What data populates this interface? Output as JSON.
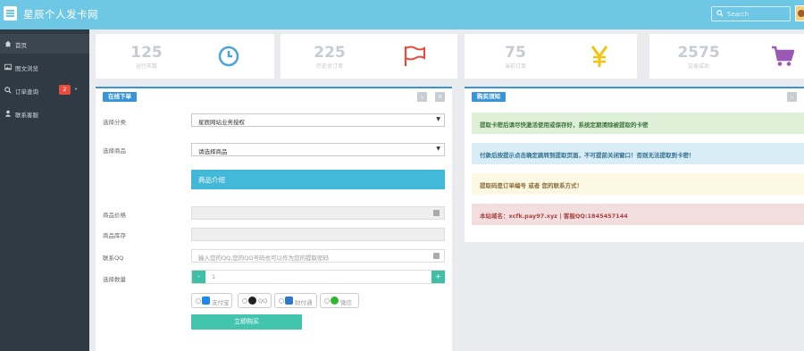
{
  "header": {
    "title": "星辰个人发卡网",
    "search_placeholder": "Search"
  },
  "sidebar": {
    "items": [
      {
        "label": "首页",
        "icon": "home-icon"
      },
      {
        "label": "图文浏览",
        "icon": "image-icon"
      },
      {
        "label": "订单查询",
        "icon": "search-icon",
        "badge": "2"
      },
      {
        "label": "联系客服",
        "icon": "user-icon"
      }
    ]
  },
  "stats": [
    {
      "value": "125",
      "caption": "运行天数",
      "icon": "clock-icon",
      "color": "#4aa3df"
    },
    {
      "value": "225",
      "caption": "历史总订单",
      "icon": "flag-icon",
      "color": "#e74c3c"
    },
    {
      "value": "75",
      "caption": "当前订单",
      "icon": "yen-icon",
      "color": "#f1c40f"
    },
    {
      "value": "2575",
      "caption": "交易成功",
      "icon": "cart-icon",
      "color": "#9b59b6"
    }
  ],
  "order_panel": {
    "tag": "在线下单",
    "category_label": "选择分类",
    "category_value": "星辰网站业务授权",
    "product_label": "选择商品",
    "product_value": "请选择商品",
    "intro_label": "商品介绍",
    "price_label": "商品价格",
    "stock_label": "商品库存",
    "qq_label": "联系QQ",
    "qq_placeholder": "输入您的QQ,您的QQ号码也可以作为您的提取密码",
    "quantity_label": "选择数量",
    "quantity_value": "1",
    "minus": "-",
    "plus": "+",
    "payments": [
      "支付宝",
      "QQ",
      "财付通",
      "微信"
    ],
    "buy_label": "立即购买"
  },
  "notice_panel": {
    "tag": "购买须知",
    "notes": [
      "提取卡密后请尽快激活使用或保存好，系统定期清除被提取的卡密",
      "付款后按提示点击确定跳转到提取页面，不可提前关闭窗口！否则无法提取到卡密！",
      "提取码是订单编号 或者 您的联系方式！",
      "本站域名：xcfk.pay97.xyz | 客服QQ:1845457144"
    ]
  },
  "colors": {
    "topbar": "#6fc7e6",
    "sidebar": "#2f3a43",
    "accent_blue": "#3a95d6",
    "accent_green": "#43c4ad",
    "note_green_bg": "#dff0d8",
    "note_blue_bg": "#d9edf7",
    "note_yellow_bg": "#fcf8e3",
    "note_red_bg": "#f2dede"
  }
}
